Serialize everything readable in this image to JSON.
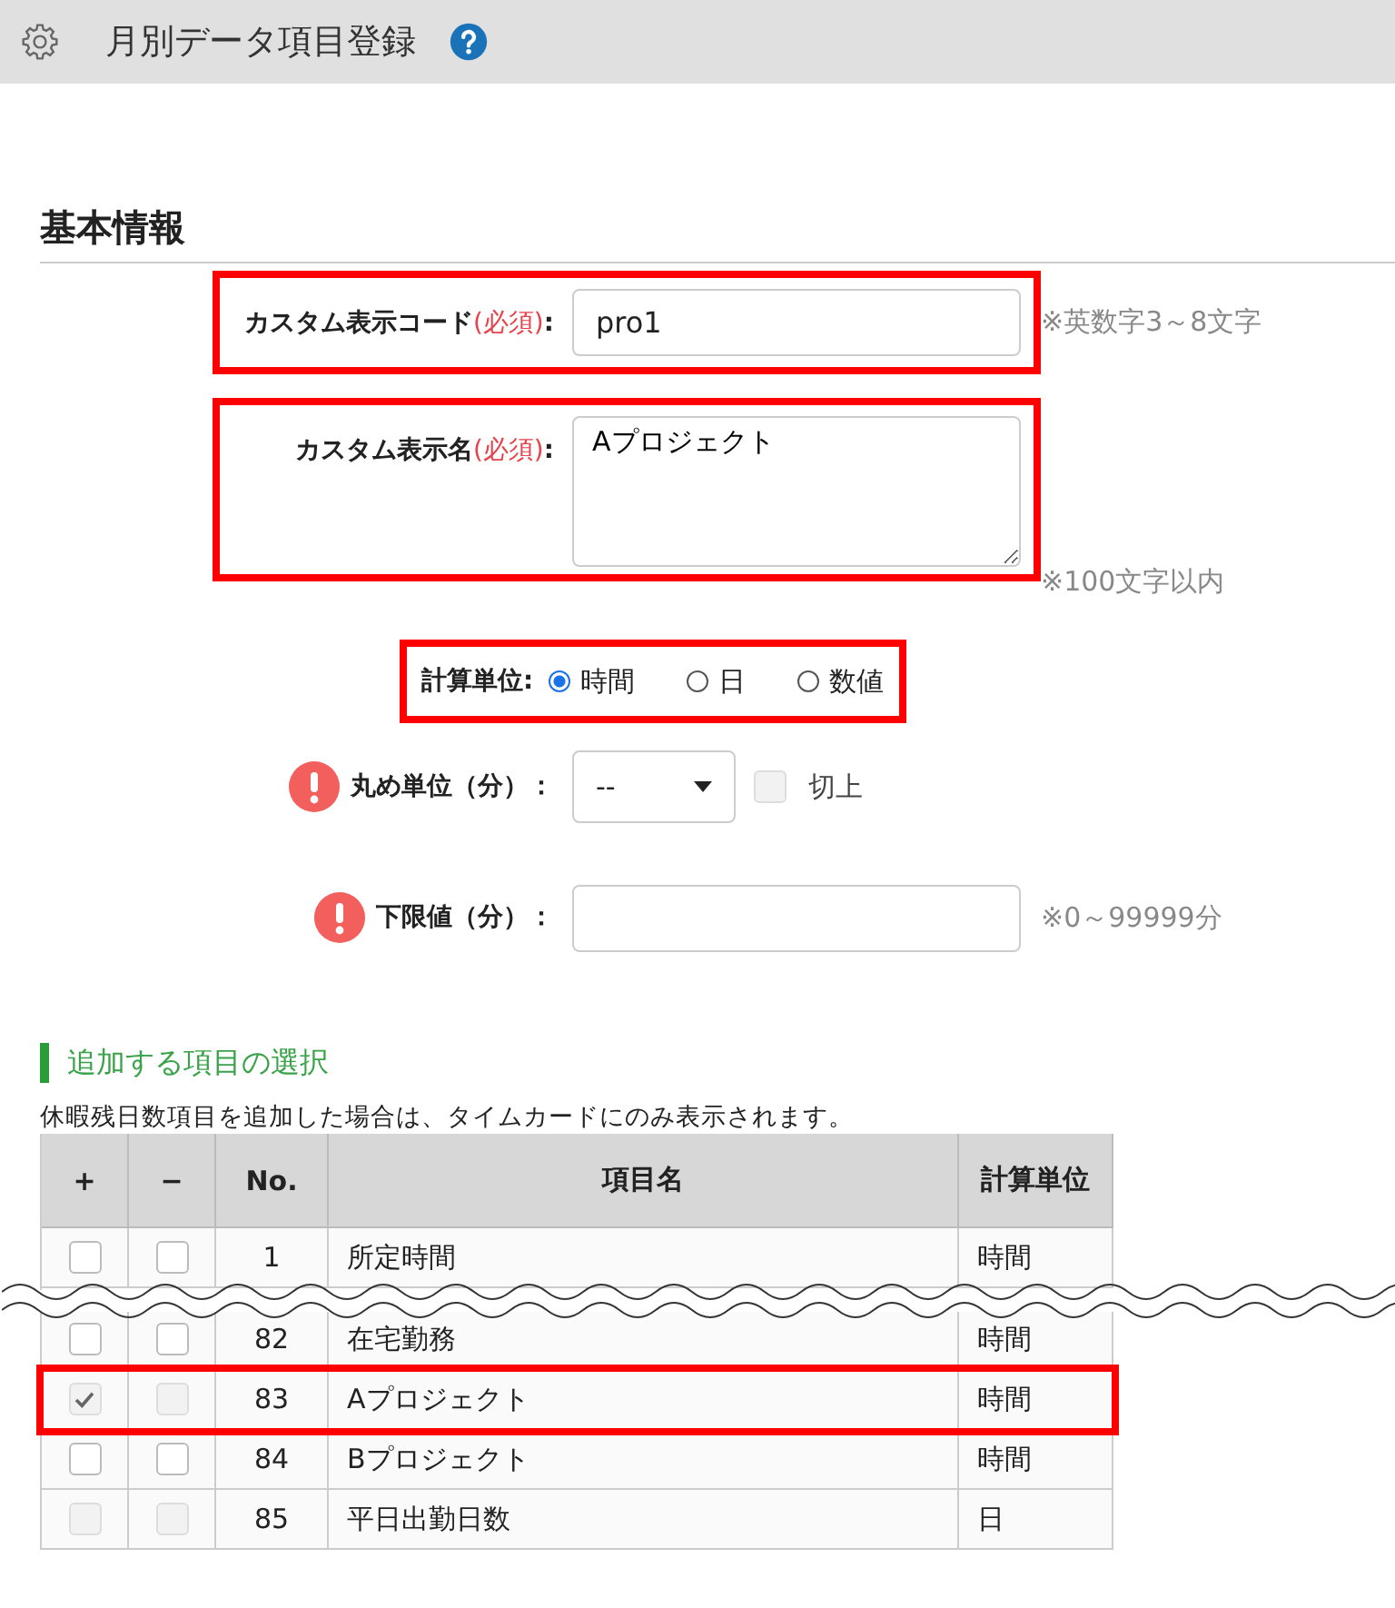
{
  "header": {
    "title": "月別データ項目登録"
  },
  "section_title": "基本情報",
  "form": [
    {
      "kind": "text",
      "label": "カスタム表示コード",
      "required_mark": "(必須)",
      "colon": ":",
      "value": "pro1",
      "hint": "※英数字3～8文字",
      "highlighted": true
    },
    {
      "kind": "textarea",
      "label": "カスタム表示名",
      "required_mark": "(必須)",
      "colon": ":",
      "value": "Aプロジェクト",
      "hint": "※100文字以内",
      "highlighted": true
    },
    {
      "kind": "radio",
      "label": "計算単位:",
      "highlighted": true,
      "options": [
        {
          "label": "時間",
          "selected": true
        },
        {
          "label": "日",
          "selected": false
        },
        {
          "label": "数値",
          "selected": false
        }
      ]
    },
    {
      "kind": "select",
      "label": "丸め単位（分）：",
      "warning": true,
      "highlighted": false,
      "value": "--",
      "checkbox": {
        "label": "切上",
        "checked": false,
        "disabled": true
      }
    },
    {
      "kind": "number",
      "label": "下限値（分）：",
      "warning": true,
      "highlighted": false,
      "hint": "※0～99999分"
    }
  ],
  "subsection_title": "追加する項目の選択",
  "note": "休暇残日数項目を追加した場合は、タイムカードにのみ表示されます。",
  "table": {
    "columns": [
      "+",
      "−",
      "No.",
      "項目名",
      "計算単位"
    ],
    "rows": [
      {
        "kind": "row",
        "add_checked": false,
        "add_disabled": false,
        "remove_checked": false,
        "remove_disabled": false,
        "no": "1",
        "name": "所定時間",
        "unit": "時間",
        "highlighted": false
      },
      {
        "kind": "break"
      },
      {
        "kind": "row",
        "add_checked": false,
        "add_disabled": false,
        "remove_checked": false,
        "remove_disabled": false,
        "no": "82",
        "name": "在宅勤務",
        "unit": "時間",
        "highlighted": false
      },
      {
        "kind": "row",
        "add_checked": true,
        "add_disabled": true,
        "remove_checked": false,
        "remove_disabled": true,
        "no": "83",
        "name": "Aプロジェクト",
        "unit": "時間",
        "highlighted": true
      },
      {
        "kind": "row",
        "add_checked": false,
        "add_disabled": false,
        "remove_checked": false,
        "remove_disabled": false,
        "no": "84",
        "name": "Bプロジェクト",
        "unit": "時間",
        "highlighted": false
      },
      {
        "kind": "row",
        "add_checked": false,
        "add_disabled": true,
        "remove_checked": false,
        "remove_disabled": true,
        "no": "85",
        "name": "平日出勤日数",
        "unit": "日",
        "highlighted": false
      }
    ]
  }
}
